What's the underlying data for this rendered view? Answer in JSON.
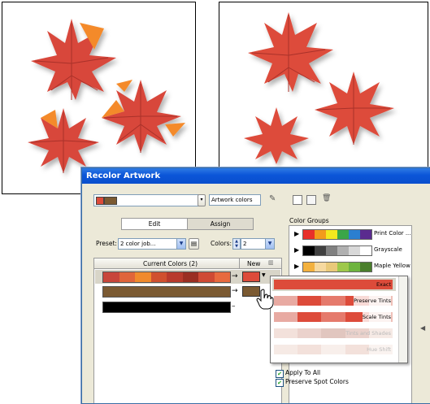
{
  "dialog": {
    "title": "Recolor Artwork",
    "preset_selector_label": "Artwork colors",
    "tabs": [
      "Edit",
      "Assign"
    ],
    "preset_label": "Preset:",
    "preset_value": "2 color job...",
    "colors_label": "Colors:",
    "colors_value": "2",
    "table_headers": {
      "current": "Current Colors (2)",
      "new": "New"
    },
    "color_groups_title": "Color Groups",
    "color_groups": [
      {
        "name": "Print Color ...",
        "colors": [
          "#e8302a",
          "#f39b1c",
          "#f3e81f",
          "#3aa648",
          "#2b7fd0",
          "#5a2b8f"
        ]
      },
      {
        "name": "Grayscale",
        "colors": [
          "#000000",
          "#404040",
          "#808080",
          "#b0b0b0",
          "#d8d8d8",
          "#ffffff"
        ]
      },
      {
        "name": "Maple Yellow",
        "colors": [
          "#f3b13e",
          "#f6d9a0",
          "#e9c97a",
          "#9ec84b",
          "#6eb43f",
          "#4a7f2c"
        ]
      }
    ],
    "menu_items": [
      "Exact",
      "Preserve Tints",
      "Scale Tints",
      "Tints and Shades",
      "Hue Shift"
    ],
    "checkboxes": [
      {
        "label": "Apply To All",
        "checked": true
      },
      {
        "label": "Preserve Spot Colors",
        "checked": true
      }
    ],
    "current_color_rows": [
      {
        "colors": [
          "#c8463a",
          "#e0653a",
          "#f08a2c",
          "#d0502e",
          "#b83a2c",
          "#9a2e22",
          "#cf4a34",
          "#e86a3e"
        ],
        "new": "#dd4b3a"
      },
      {
        "colors": [
          "#7b5a32"
        ],
        "new": "#7b5a32"
      },
      {
        "colors": [
          "#000000"
        ],
        "new": ""
      }
    ],
    "colors": {
      "accent_red": "#dd4b3a",
      "brown": "#7b5a32",
      "title_blue": "#0b55d8"
    }
  }
}
